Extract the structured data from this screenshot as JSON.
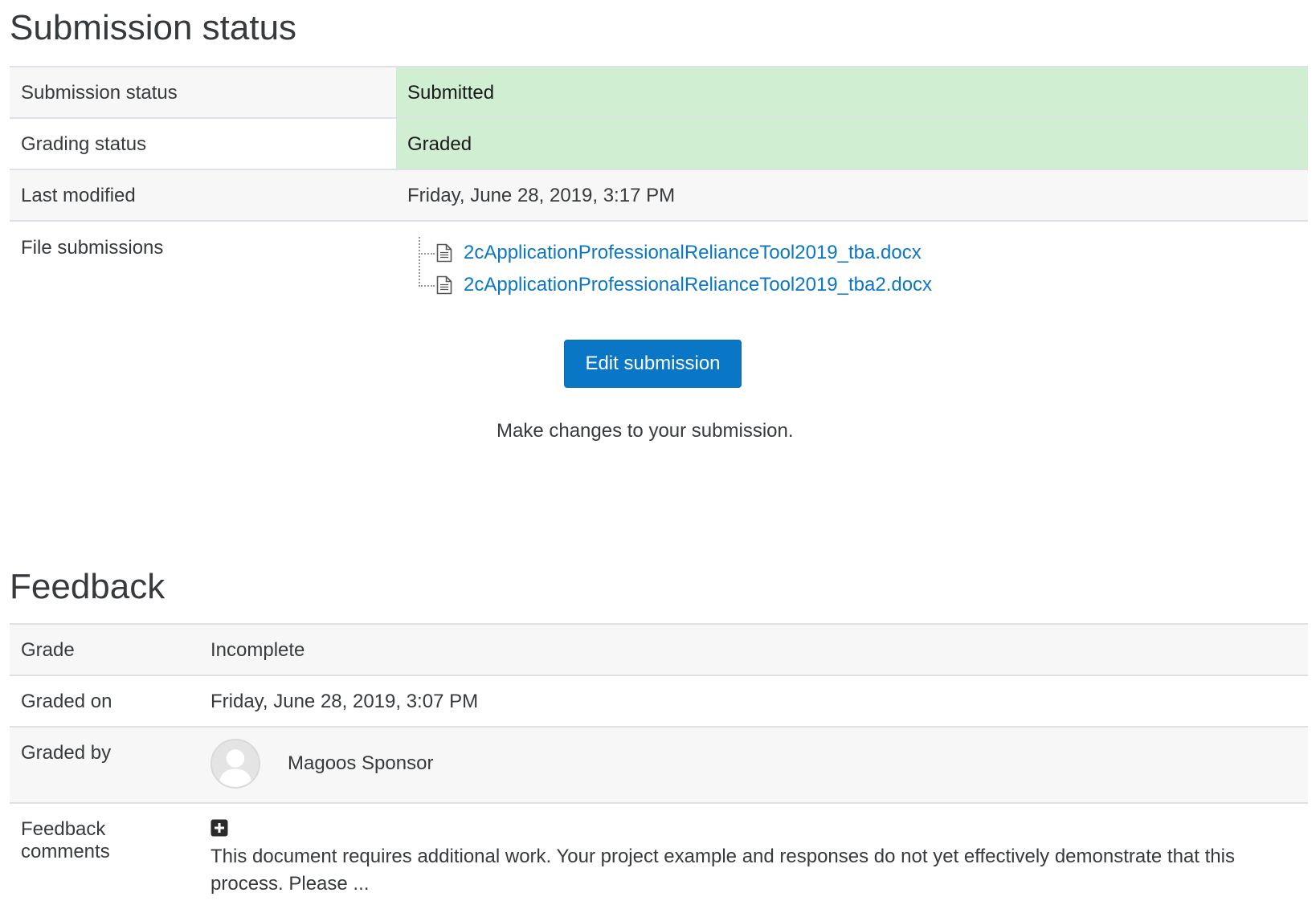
{
  "submission": {
    "title": "Submission status",
    "rows": {
      "status_label": "Submission status",
      "status_value": "Submitted",
      "grading_label": "Grading status",
      "grading_value": "Graded",
      "modified_label": "Last modified",
      "modified_value": "Friday, June 28, 2019, 3:17 PM",
      "files_label": "File submissions"
    },
    "files": [
      "2cApplicationProfessionalRelianceTool2019_tba.docx",
      "2cApplicationProfessionalRelianceTool2019_tba2.docx"
    ],
    "edit_button": "Edit submission",
    "edit_help": "Make changes to your submission."
  },
  "feedback": {
    "title": "Feedback",
    "grade_label": "Grade",
    "grade_value": "Incomplete",
    "graded_on_label": "Graded on",
    "graded_on_value": "Friday, June 28, 2019, 3:07 PM",
    "graded_by_label": "Graded by",
    "grader_name": "Magoos Sponsor",
    "comments_label": "Feedback comments",
    "comments_text": "This document requires additional work. Your project example and responses do not yet effectively demonstrate that this process. Please ..."
  },
  "icons": {
    "file": "file-document-icon",
    "avatar": "user-avatar-icon",
    "expand": "plus-square-icon"
  },
  "colors": {
    "success_bg": "#d0efd2",
    "link": "#0a77c6",
    "primary_button": "#0a77c6",
    "text": "#373a3c"
  }
}
